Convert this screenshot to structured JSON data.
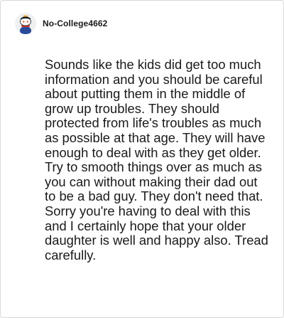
{
  "comment": {
    "username": "No-College4662",
    "avatar_icon": "snoo-avatar-icon",
    "body": "Sounds like the kids did get too much information and you should be careful about putting them in the middle of grow up troubles. They should protected from life's troubles as much as possible at that age. They will have enough to deal with as they get older. Try to smooth things over as much as you can without making their dad out to be a bad guy. They don't need that. Sorry you're having to deal with this and I certainly hope that your older daughter is well and happy also. Tread carefully."
  }
}
